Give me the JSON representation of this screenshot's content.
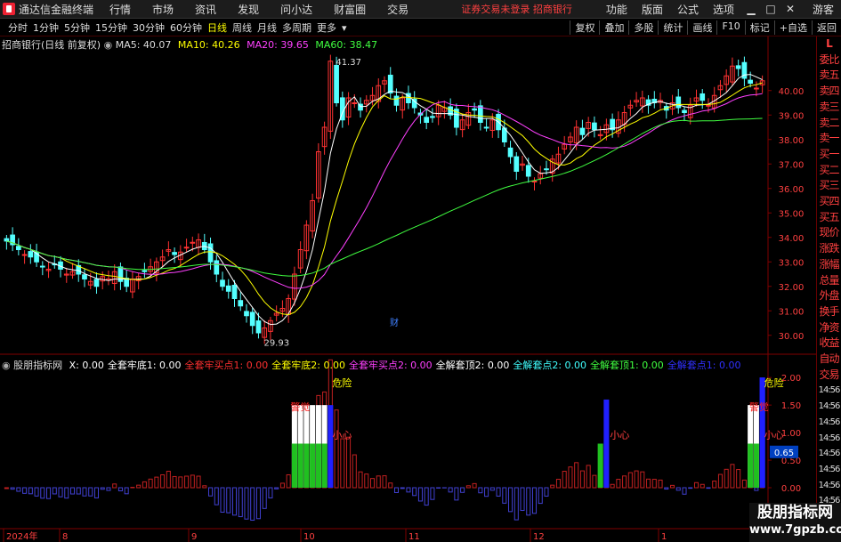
{
  "app": {
    "title": "通达信金融终端"
  },
  "menu": [
    "行情",
    "市场",
    "资讯",
    "发现",
    "问小达",
    "财富圈",
    "交易"
  ],
  "warning": {
    "text": "证券交易未登录  招商银行"
  },
  "right_menu": [
    "功能",
    "版面",
    "公式",
    "选项"
  ],
  "guest": "游客",
  "periods": [
    "分时",
    "1分钟",
    "5分钟",
    "15分钟",
    "30分钟",
    "60分钟",
    "日线",
    "周线",
    "月线",
    "多周期",
    "更多"
  ],
  "active_period": "日线",
  "toolbar_right": [
    "复权",
    "叠加",
    "多股",
    "统计",
    "画线",
    "F10",
    "标记",
    "+自选",
    "返回"
  ],
  "chart_title": {
    "name": "招商银行(日线 前复权)",
    "ma5": "MA5: 40.07",
    "ma10": "MA10: 40.26",
    "ma20": "MA20: 39.65",
    "ma60": "MA60: 38.47"
  },
  "price_axis": [
    "40.00",
    "39.00",
    "38.00",
    "37.00",
    "36.00",
    "35.00",
    "34.00",
    "33.00",
    "32.00",
    "31.00",
    "30.00"
  ],
  "price_high_label": "41.37",
  "price_low_label": "29.93",
  "event_marker": "财",
  "indicator_title": {
    "name": "股朋指标网",
    "items": [
      {
        "text": "X: 0.00",
        "color": "#ffffff"
      },
      {
        "text": "全套牢底1: 0.00",
        "color": "#ffffff"
      },
      {
        "text": "全套牢买点1: 0.00",
        "color": "#ff3030"
      },
      {
        "text": "全套牢底2: 0.00",
        "color": "#ffff00"
      },
      {
        "text": "全套牢买点2: 0.00",
        "color": "#ff40ff"
      },
      {
        "text": "全解套顶2: 0.00",
        "color": "#ffffff"
      },
      {
        "text": "全解套点2: 0.00",
        "color": "#40ffff"
      },
      {
        "text": "全解套顶1: 0.00",
        "color": "#40ff40"
      },
      {
        "text": "全解套点1: 0.00",
        "color": "#3030ff"
      }
    ]
  },
  "indicator_axis": [
    "2.00",
    "1.50",
    "1.00",
    "0.50",
    "0.00"
  ],
  "indicator_value": "0.65",
  "indicator_labels": {
    "danger": "危险",
    "careful": "小心",
    "alert": "警觉"
  },
  "date_axis": [
    "2024年",
    "8",
    "9",
    "10",
    "11",
    "12",
    "1"
  ],
  "right_panel": [
    "委比",
    "卖五",
    "卖四",
    "卖三",
    "卖二",
    "卖一",
    "买一",
    "买二",
    "买三",
    "买四",
    "买五",
    "现价",
    "涨跌",
    "涨幅",
    "总量",
    "外盘",
    "换手",
    "净资",
    "收益",
    "自动",
    "交易",
    "14:56",
    "14:56",
    "14:56",
    "14:56",
    "14:56",
    "14:56",
    "14:56",
    "14:56"
  ],
  "right_top_label": "L",
  "watermark": {
    "line1": "股朋指标网",
    "line2": "www.7gpzb.com"
  },
  "colors": {
    "up": "#ff3232",
    "down": "#54ffff",
    "ma5": "#ffffff",
    "ma10": "#ffff00",
    "ma20": "#ff40ff",
    "ma60": "#40ff40"
  },
  "chart_data": {
    "type": "candlestick",
    "ylim": [
      29.7,
      41.7
    ],
    "closes": [
      33.85,
      33.7,
      33.5,
      33.3,
      33.2,
      33.0,
      32.8,
      32.7,
      32.9,
      32.7,
      32.5,
      32.6,
      32.5,
      32.3,
      32.2,
      32.0,
      32.4,
      32.3,
      32.6,
      32.2,
      32.0,
      32.3,
      32.4,
      32.6,
      32.8,
      33.0,
      33.2,
      33.5,
      33.3,
      33.4,
      33.6,
      33.8,
      33.9,
      33.5,
      33.0,
      32.5,
      32.0,
      31.8,
      31.5,
      31.2,
      30.8,
      30.4,
      30.1,
      30.3,
      30.6,
      30.9,
      31.1,
      31.5,
      32.5,
      33.5,
      34.5,
      35.5,
      37.5,
      38.5,
      41.2,
      39.5,
      38.8,
      39.7,
      39.5,
      39.2,
      39.6,
      39.8,
      40.2,
      40.4,
      39.9,
      39.4,
      39.7,
      39.5,
      39.3,
      39.0,
      38.7,
      38.9,
      39.4,
      39.3,
      39.0,
      38.5,
      38.8,
      39.1,
      39.2,
      38.7,
      38.5,
      38.8,
      38.4,
      37.9,
      37.3,
      36.7,
      37.0,
      36.5,
      36.3,
      36.6,
      36.8,
      37.2,
      37.4,
      37.8,
      38.1,
      38.5,
      38.2,
      38.7,
      38.4,
      38.2,
      38.6,
      38.4,
      38.8,
      39.1,
      39.4,
      39.6,
      39.7,
      39.4,
      39.5,
      39.6,
      39.2,
      39.5,
      39.3,
      39.1,
      39.4,
      39.7,
      39.6,
      39.4,
      39.8,
      40.2,
      40.6,
      41.0,
      40.9,
      40.5,
      40.3,
      40.1,
      40.4
    ]
  }
}
